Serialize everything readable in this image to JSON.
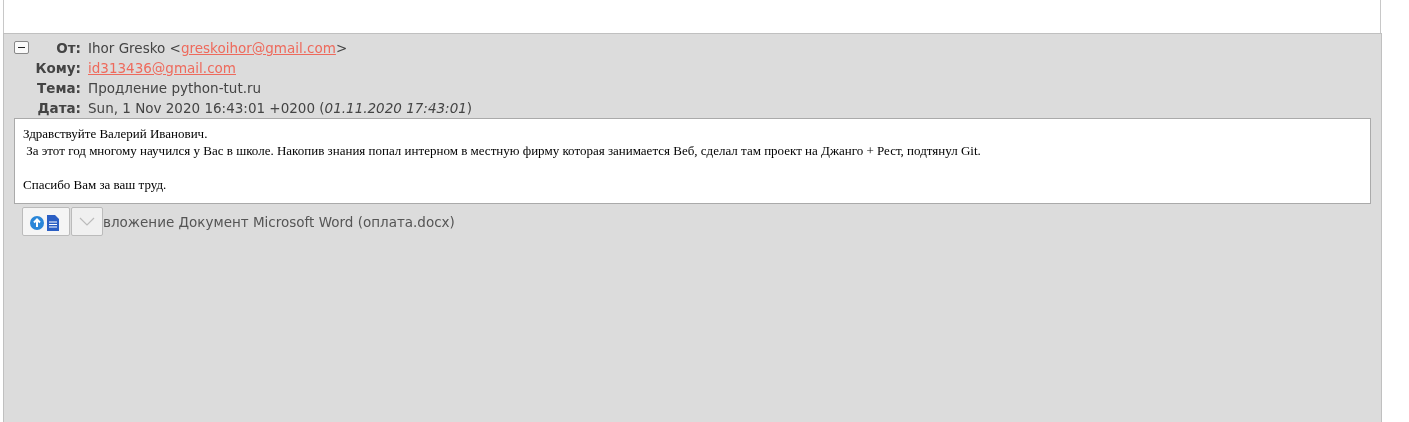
{
  "message": {
    "expanded": true,
    "headers": [
      {
        "kind": "from",
        "label": "От:",
        "name": "Ihor Gresko <",
        "email": "greskoihor@gmail.com",
        "suffix": ">"
      },
      {
        "kind": "link",
        "label": "Кому:",
        "value": "id313436@gmail.com"
      },
      {
        "kind": "text",
        "label": "Тема:",
        "value": "Продление python-tut.ru"
      },
      {
        "kind": "text",
        "label": "Дата:",
        "value": "Sun, 1 Nov 2020 16:43:01 +0200 (*01.11.2020 17:43:01*)"
      }
    ],
    "body": [
      [
        "Здравствуйте Валерий Иванович.",
        " За этот год многому научился у Вас в школе. Накопив знания попал интерном в местную фирму которая занимается Веб, сделал там проект на Джанго + Рест, подтянул Git."
      ],
      [
        "Спасибо Вам за ваш труд."
      ]
    ],
    "attachment": {
      "label": "вложение Документ Microsoft Word (оплата.docx)"
    }
  }
}
